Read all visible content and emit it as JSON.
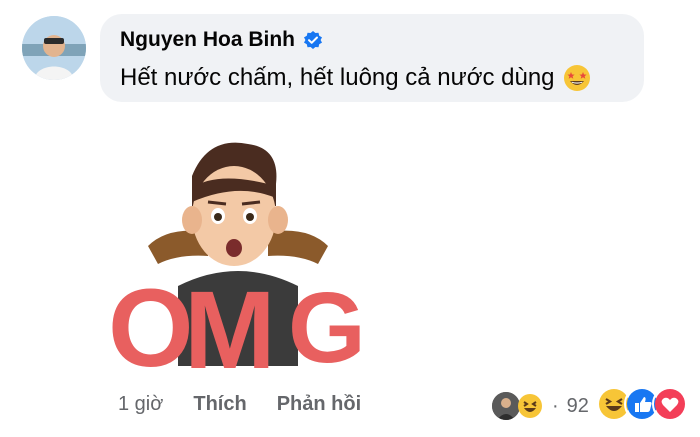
{
  "comment": {
    "author": "Nguyen Hoa Binh",
    "text": "Hết nước chấm, hết luông cả nước dùng",
    "emoji_icon": "star-struck-emoji-icon",
    "sticker_text": "OMG"
  },
  "actions": {
    "time": "1 giờ",
    "like_label": "Thích",
    "reply_label": "Phản hồi"
  },
  "reactions": {
    "count": "92",
    "separator": "·",
    "icons": [
      "haha-icon",
      "like-icon",
      "love-icon"
    ]
  },
  "colors": {
    "bubble_bg": "#f0f2f5",
    "text": "#050505",
    "secondary_text": "#65676b",
    "verified_blue": "#1877f2",
    "omg_red": "#e8605f"
  }
}
